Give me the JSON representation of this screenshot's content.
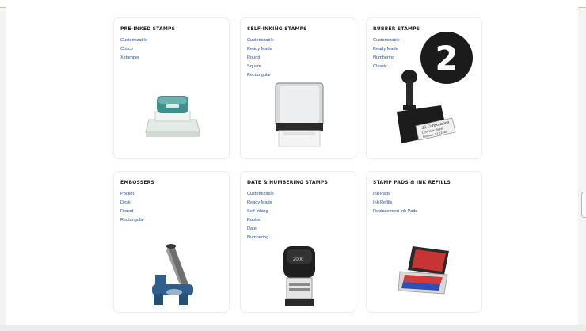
{
  "badge_number": "2",
  "cards": [
    {
      "title": "PRE-INKED STAMPS",
      "links": [
        "Customizable",
        "Cosco",
        "Xstamper"
      ],
      "image": "pre-inked-stamp-image"
    },
    {
      "title": "SELF-INKING STAMPS",
      "links": [
        "Customizable",
        "Ready Made",
        "Round",
        "Square",
        "Rectangular"
      ],
      "image": "self-inking-stamp-image"
    },
    {
      "title": "RUBBER STAMPS",
      "links": [
        "Customizable",
        "Ready Made",
        "Numbering",
        "Classic"
      ],
      "image": "rubber-stamp-image",
      "image_text": [
        "JS Construction",
        "1234 Main Street",
        "Anytown, ST 12345"
      ]
    },
    {
      "title": "EMBOSSERS",
      "links": [
        "Pocket",
        "Desk",
        "Round",
        "Rectangular"
      ],
      "image": "embosser-image"
    },
    {
      "title": "DATE & NUMBERING STAMPS",
      "links": [
        "Customizable",
        "Ready Made",
        "Self-Inking",
        "Rubber",
        "Date",
        "Numbering"
      ],
      "image": "date-stamp-image",
      "image_text": "2000"
    },
    {
      "title": "STAMP PADS & INK REFILLS",
      "links": [
        "Ink Pads",
        "Ink Refills",
        "Replacement Ink Pads"
      ],
      "image": "ink-pad-image"
    }
  ],
  "colors": {
    "link": "#2b4f9f",
    "pre_inked_teal": "#3f8f8c",
    "embosser_blue": "#2f5f8a",
    "ink_red": "#d23a3a",
    "ink_blue": "#2e4fb3"
  }
}
